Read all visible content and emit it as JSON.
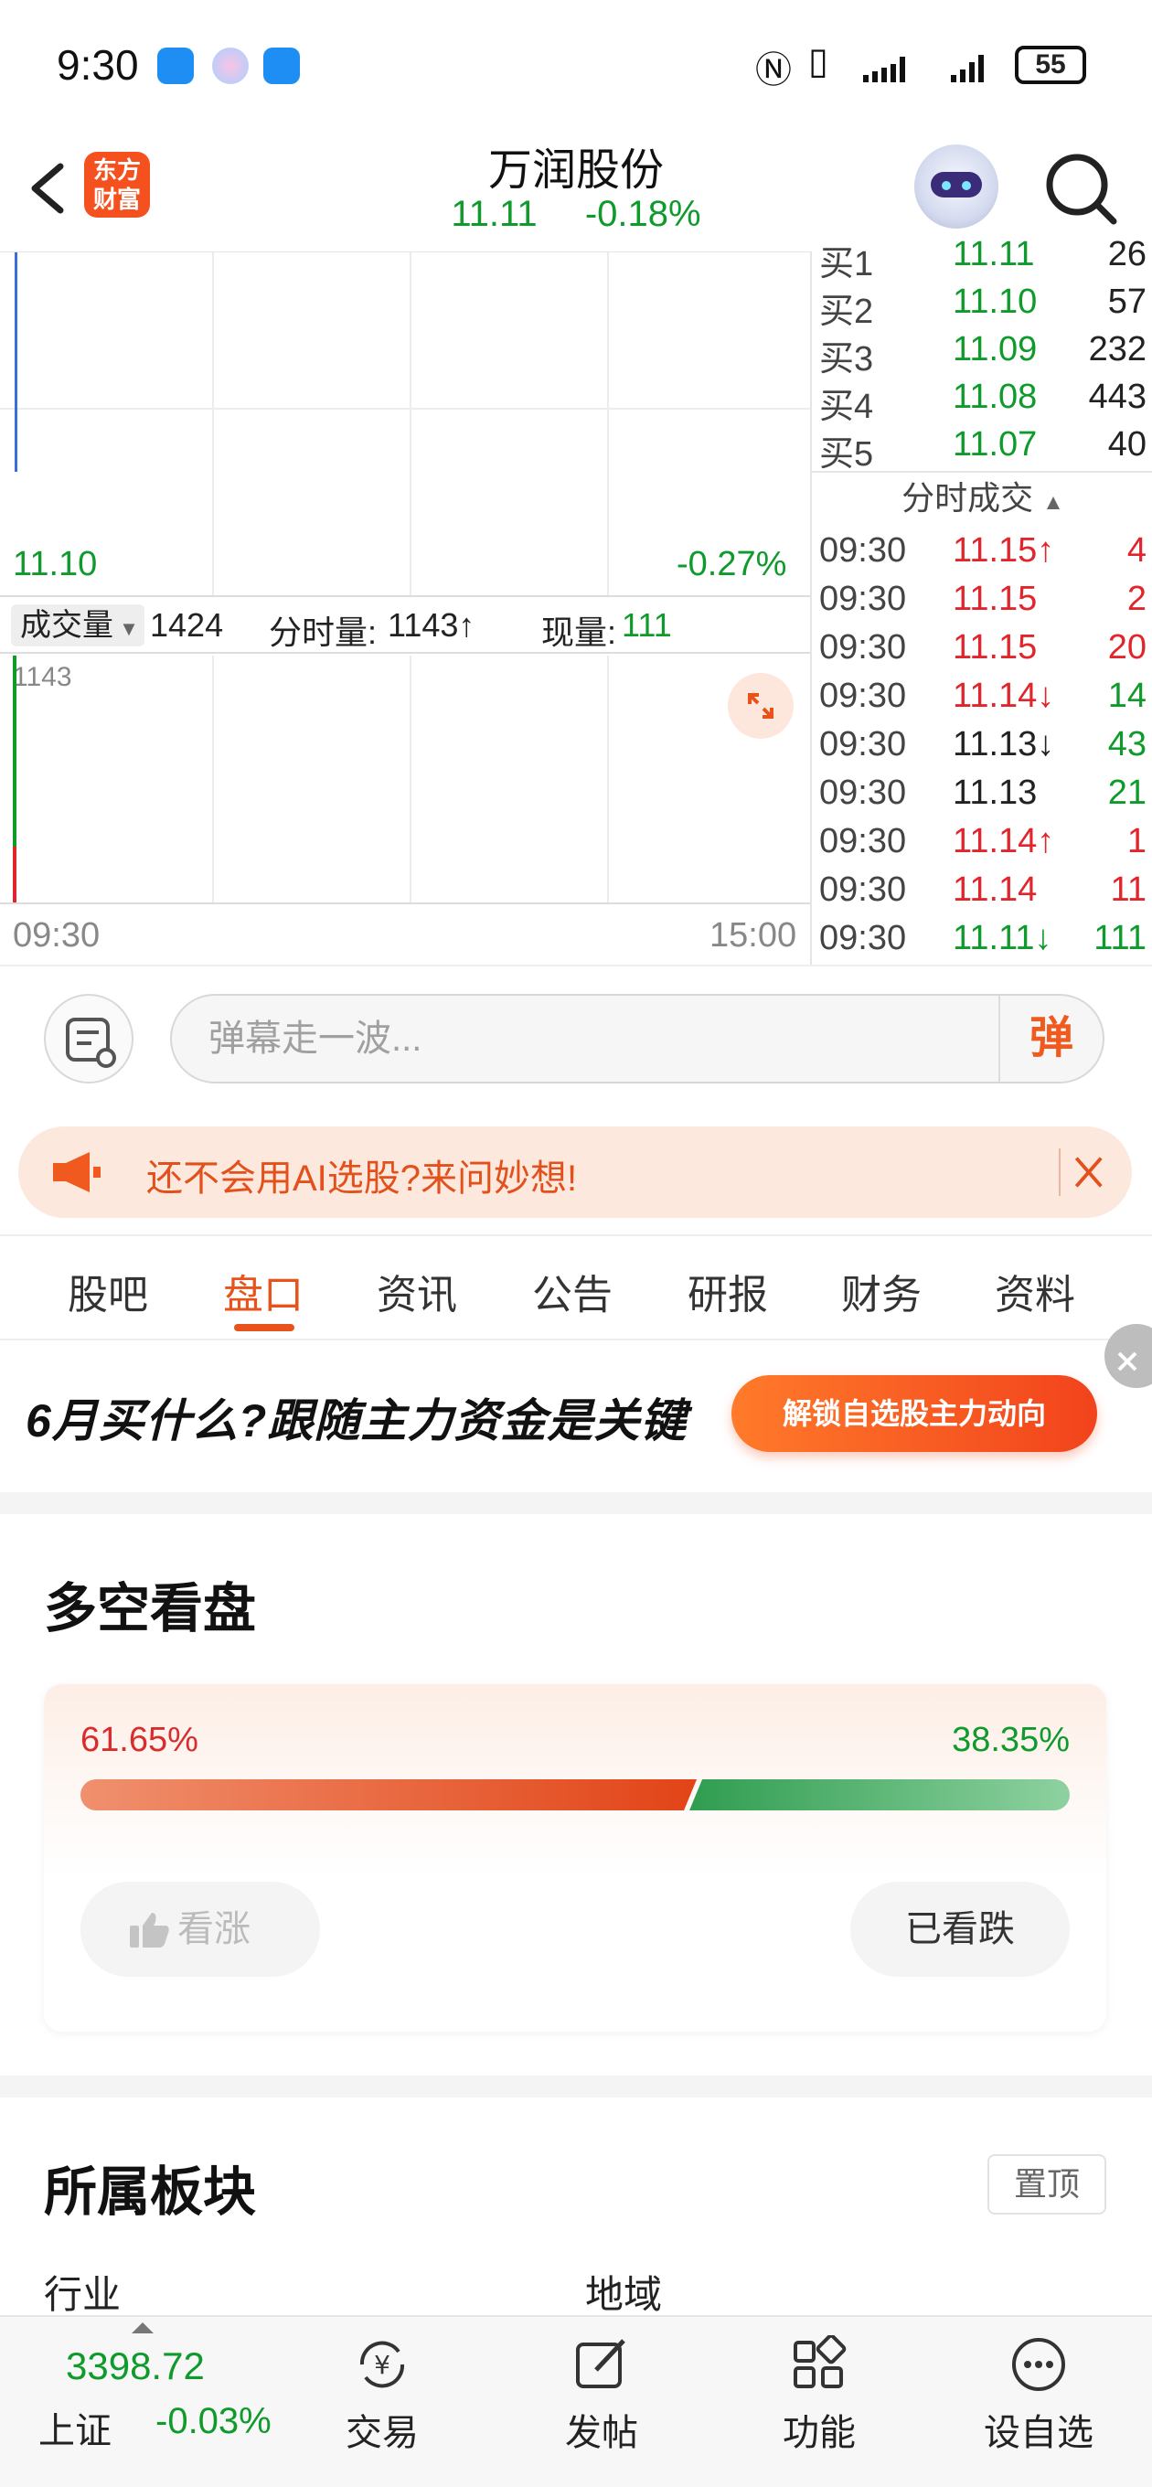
{
  "status_bar": {
    "time": "9:30",
    "battery": "55"
  },
  "header": {
    "logo_text_1": "东方",
    "logo_text_2": "财富",
    "stock_name": "万润股份",
    "price": "11.11",
    "change_pct": "-0.18%"
  },
  "chart": {
    "price_low": "11.10",
    "pct_low": "-0.27%",
    "volume_selector": "成交量",
    "volume_value": "1424",
    "minute_volume_label": "分时量:",
    "minute_volume_value": "1143↑",
    "current_volume_label": "现量:",
    "current_volume_value": "111",
    "vol_axis_max": "1143",
    "time_start": "09:30",
    "time_end": "15:00"
  },
  "order_book": {
    "bids": [
      {
        "label": "买1",
        "price": "11.11",
        "volume": "26"
      },
      {
        "label": "买2",
        "price": "11.10",
        "volume": "57"
      },
      {
        "label": "买3",
        "price": "11.09",
        "volume": "232"
      },
      {
        "label": "买4",
        "price": "11.08",
        "volume": "443"
      },
      {
        "label": "买5",
        "price": "11.07",
        "volume": "40"
      }
    ],
    "ticks_header": "分时成交",
    "ticks": [
      {
        "time": "09:30",
        "price": "11.15↑",
        "volume": "4",
        "pcolor": "red",
        "vcolor": "red"
      },
      {
        "time": "09:30",
        "price": "11.15",
        "volume": "2",
        "pcolor": "red",
        "vcolor": "red"
      },
      {
        "time": "09:30",
        "price": "11.15",
        "volume": "20",
        "pcolor": "red",
        "vcolor": "red"
      },
      {
        "time": "09:30",
        "price": "11.14↓",
        "volume": "14",
        "pcolor": "red",
        "vcolor": "green"
      },
      {
        "time": "09:30",
        "price": "11.13↓",
        "volume": "43",
        "pcolor": "dark",
        "vcolor": "green"
      },
      {
        "time": "09:30",
        "price": "11.13",
        "volume": "21",
        "pcolor": "dark",
        "vcolor": "green"
      },
      {
        "time": "09:30",
        "price": "11.14↑",
        "volume": "1",
        "pcolor": "red",
        "vcolor": "red"
      },
      {
        "time": "09:30",
        "price": "11.14",
        "volume": "11",
        "pcolor": "red",
        "vcolor": "red"
      },
      {
        "time": "09:30",
        "price": "11.11↓",
        "volume": "111",
        "pcolor": "green",
        "vcolor": "green"
      }
    ]
  },
  "danmaku": {
    "placeholder": "弹幕走一波...",
    "send_label": "弹"
  },
  "ai_banner": {
    "text": "还不会用AI选股?来问妙想!"
  },
  "tabs": [
    {
      "label": "股吧"
    },
    {
      "label": "盘口"
    },
    {
      "label": "资讯"
    },
    {
      "label": "公告"
    },
    {
      "label": "研报"
    },
    {
      "label": "财务"
    },
    {
      "label": "资料"
    }
  ],
  "ad": {
    "text": "6月买什么?跟随主力资金是关键",
    "button": "解锁自选股主力动向"
  },
  "sentiment": {
    "title": "多空看盘",
    "bull_pct": "61.65%",
    "bear_pct": "38.35%",
    "bull_fraction": 0.6165,
    "bull_button": "看涨",
    "bear_button": "已看跌"
  },
  "sector": {
    "title": "所属板块",
    "pin_label": "置顶",
    "industry_label": "行业",
    "region_label": "地域"
  },
  "bottom_nav": {
    "index_value": "3398.72",
    "index_name": "上证",
    "index_pct": "-0.03%",
    "items": [
      {
        "label": "交易",
        "icon": "trade-icon"
      },
      {
        "label": "发帖",
        "icon": "edit-icon"
      },
      {
        "label": "功能",
        "icon": "grid-icon"
      },
      {
        "label": "设自选",
        "icon": "more-icon"
      }
    ]
  },
  "colors": {
    "accent": "#e8531b",
    "up": "#e0262c",
    "down": "#0f9a2c"
  }
}
